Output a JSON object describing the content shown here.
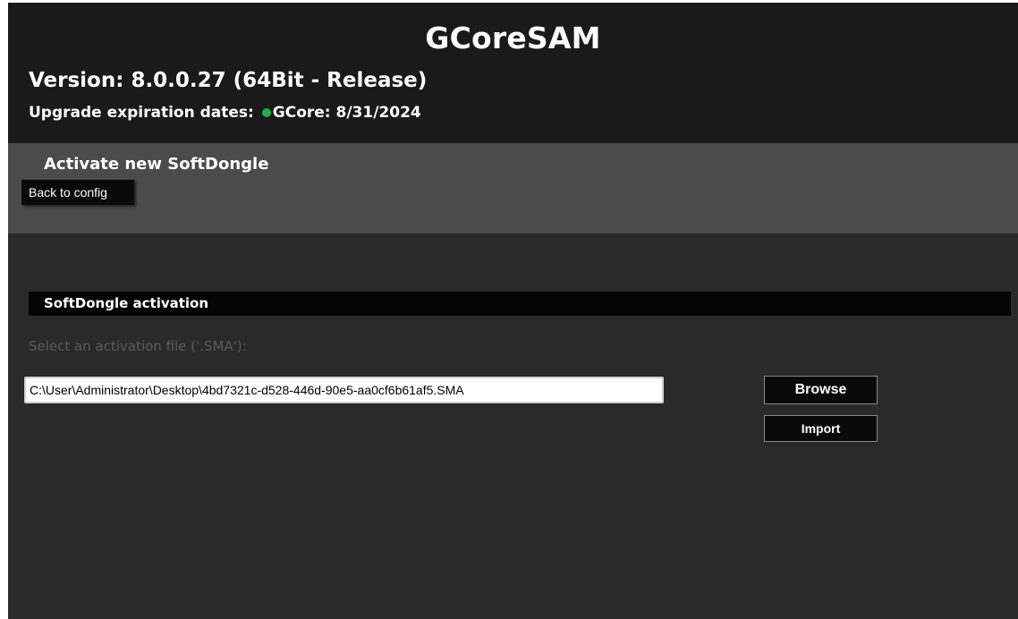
{
  "header": {
    "app_title": "GCoreSAM",
    "version": "Version: 8.0.0.27 (64Bit - Release)",
    "upgrade_label": "Upgrade expiration dates:",
    "upgrade_value": "GCore: 8/31/2024",
    "status_dot_color": "#22b14c"
  },
  "subheader": {
    "page_title": "Activate new SoftDongle",
    "back_button_label": "Back to config"
  },
  "activation": {
    "section_title": "SoftDongle activation",
    "select_label": "Select an activation file ('.SMA'):",
    "file_path_value": "C:\\User\\Administrator\\Desktop\\4bd7321c-d528-446d-90e5-aa0cf6b61af5.SMA",
    "browse_label": "Browse",
    "import_label": "Import"
  },
  "colors": {
    "header_bg": "#1a1a1b",
    "subheader_bg": "#4b4b4c",
    "body_bg": "#2a2a2b",
    "section_bar_bg": "#050505"
  }
}
